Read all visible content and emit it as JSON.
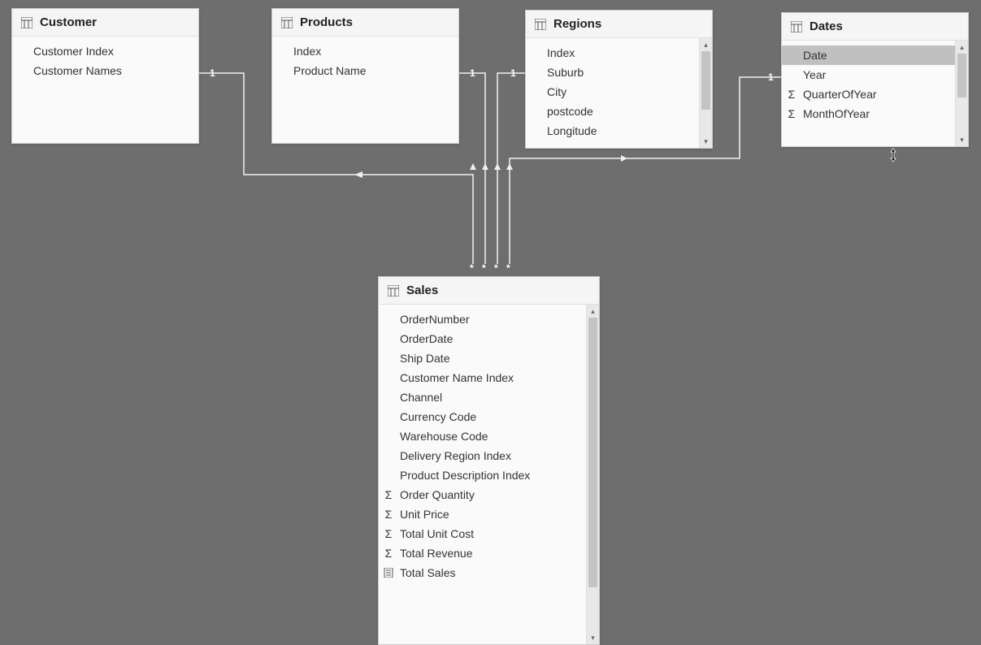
{
  "tables": {
    "customer": {
      "title": "Customer",
      "fields": [
        {
          "label": "Customer Index",
          "icon": ""
        },
        {
          "label": "Customer Names",
          "icon": ""
        }
      ]
    },
    "products": {
      "title": "Products",
      "fields": [
        {
          "label": "Index",
          "icon": ""
        },
        {
          "label": "Product Name",
          "icon": ""
        }
      ]
    },
    "regions": {
      "title": "Regions",
      "fields": [
        {
          "label": "Index",
          "icon": ""
        },
        {
          "label": "Suburb",
          "icon": ""
        },
        {
          "label": "City",
          "icon": ""
        },
        {
          "label": "postcode",
          "icon": ""
        },
        {
          "label": "Longitude",
          "icon": ""
        }
      ]
    },
    "dates": {
      "title": "Dates",
      "fields": [
        {
          "label": "Date",
          "icon": "",
          "selected": true
        },
        {
          "label": "Year",
          "icon": ""
        },
        {
          "label": "QuarterOfYear",
          "icon": "sigma"
        },
        {
          "label": "MonthOfYear",
          "icon": "sigma"
        }
      ]
    },
    "sales": {
      "title": "Sales",
      "fields": [
        {
          "label": "OrderNumber",
          "icon": ""
        },
        {
          "label": "OrderDate",
          "icon": ""
        },
        {
          "label": "Ship Date",
          "icon": ""
        },
        {
          "label": "Customer Name Index",
          "icon": ""
        },
        {
          "label": "Channel",
          "icon": ""
        },
        {
          "label": "Currency Code",
          "icon": ""
        },
        {
          "label": "Warehouse Code",
          "icon": ""
        },
        {
          "label": "Delivery Region Index",
          "icon": ""
        },
        {
          "label": "Product Description Index",
          "icon": ""
        },
        {
          "label": "Order Quantity",
          "icon": "sigma"
        },
        {
          "label": "Unit Price",
          "icon": "sigma"
        },
        {
          "label": "Total Unit Cost",
          "icon": "sigma"
        },
        {
          "label": "Total Revenue",
          "icon": "sigma"
        },
        {
          "label": "Total Sales",
          "icon": "calc"
        }
      ]
    }
  },
  "relationships": {
    "one_label": "1",
    "many_label": "*"
  }
}
